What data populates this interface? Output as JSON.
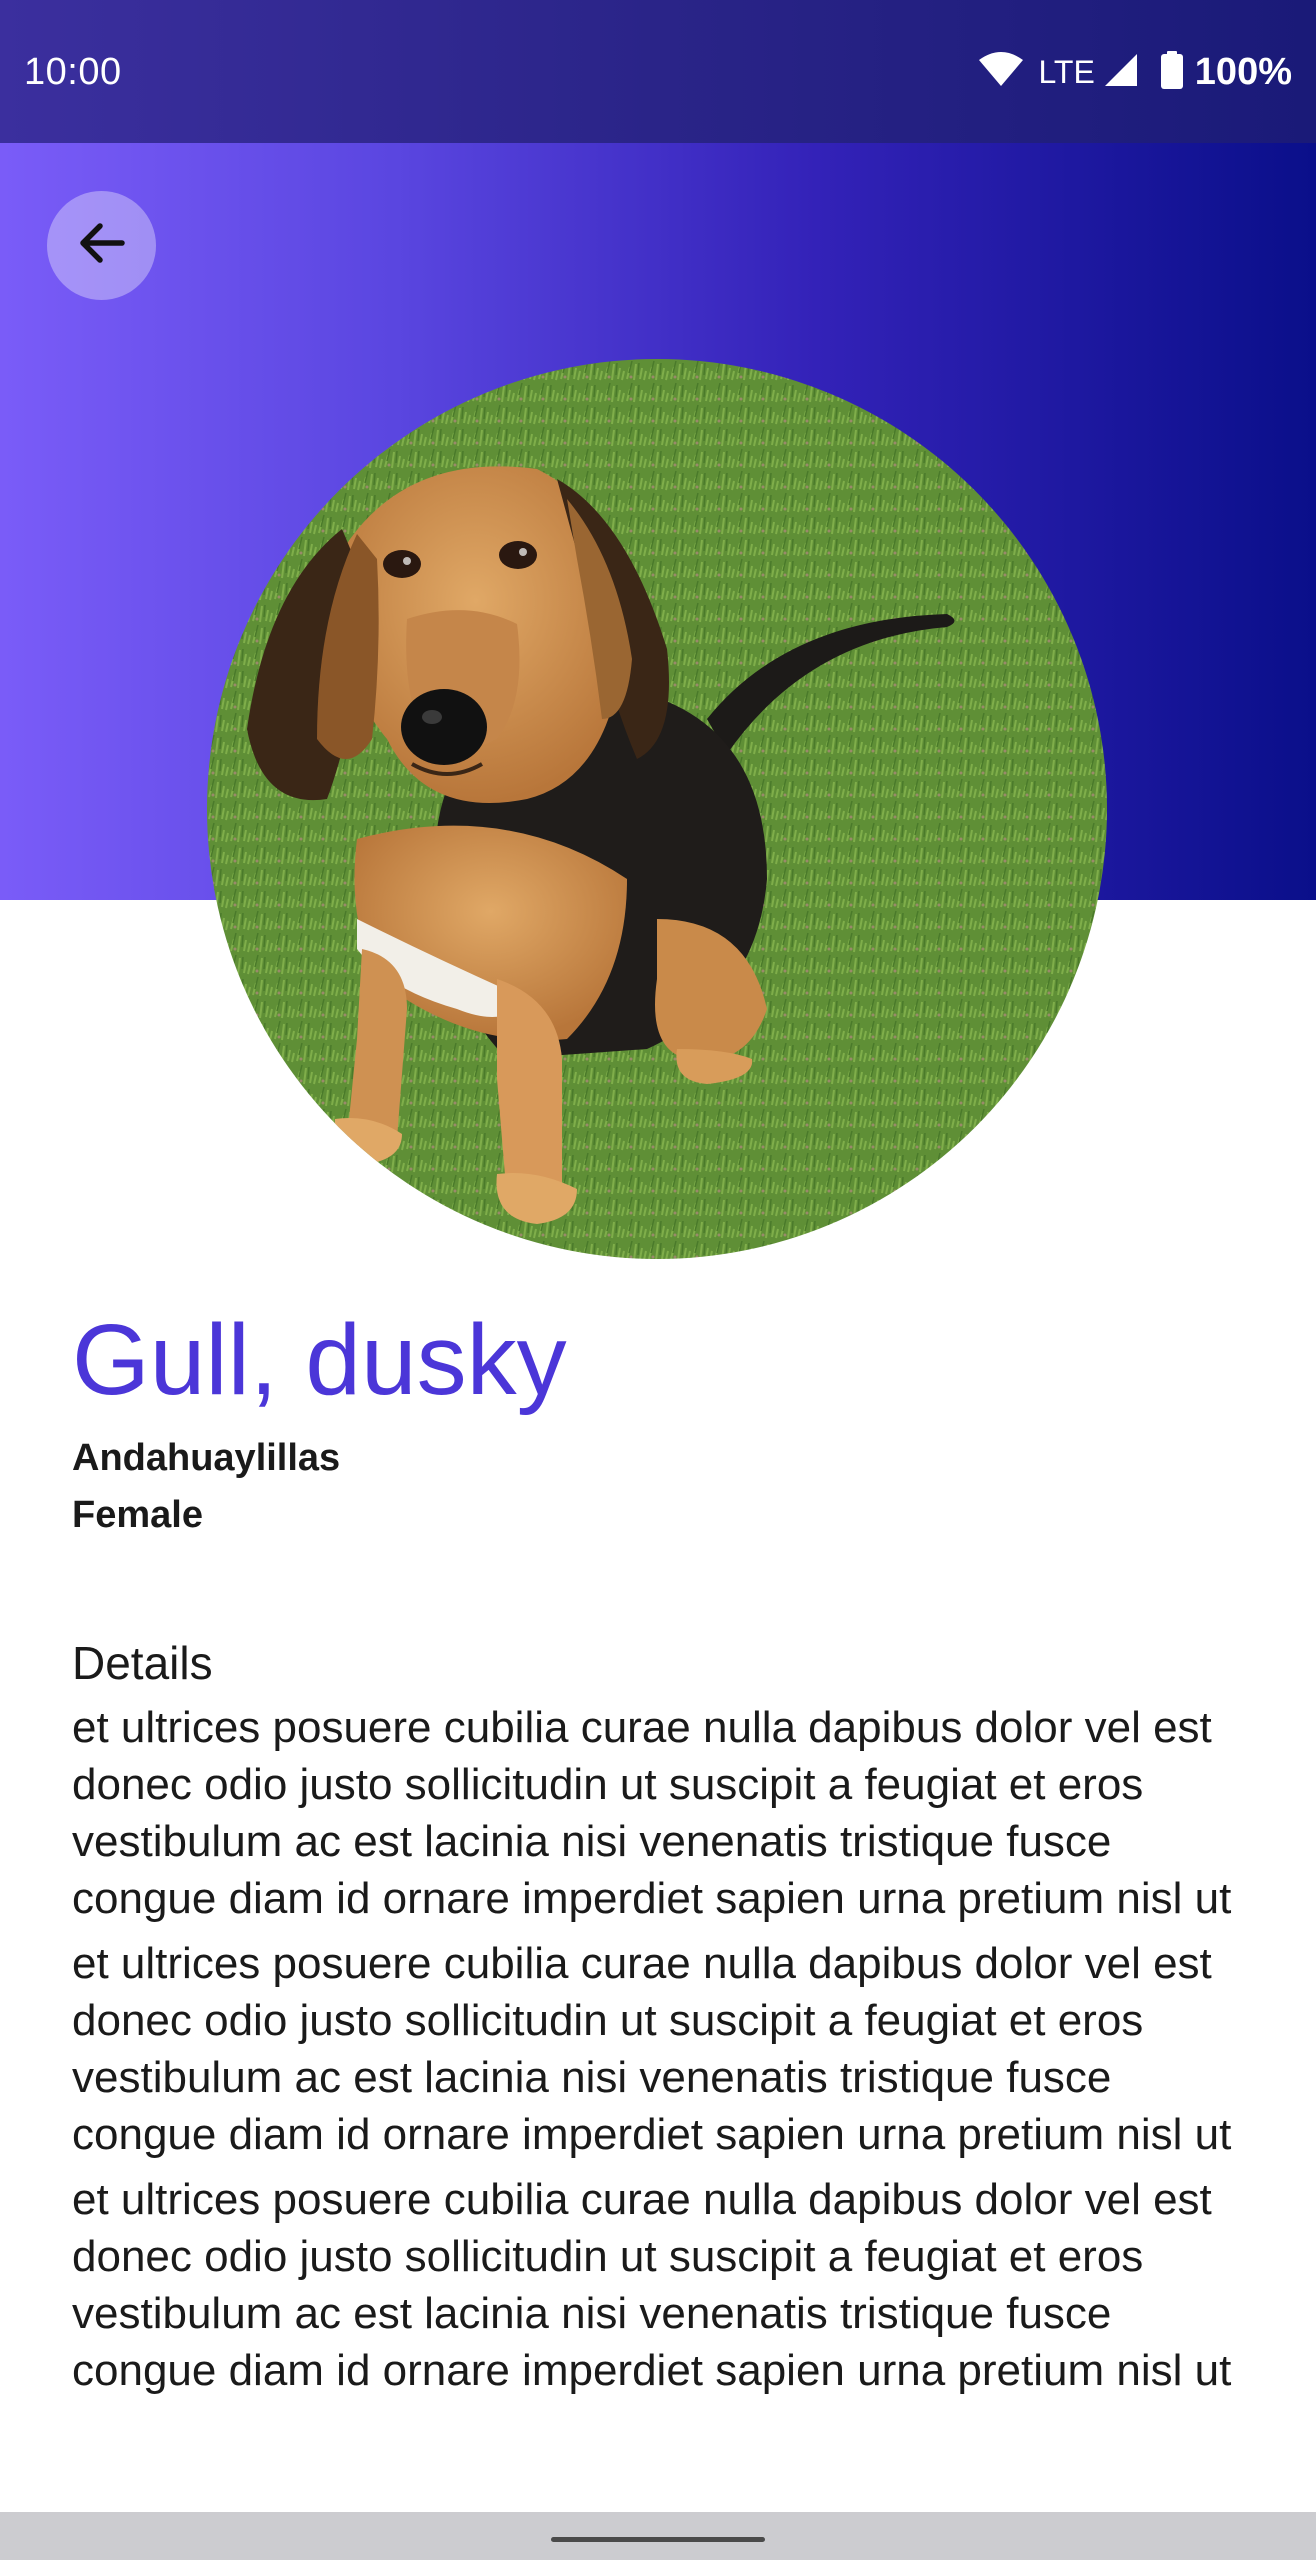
{
  "status_bar": {
    "time": "10:00",
    "network": "LTE",
    "battery": "100%",
    "icons": [
      "wifi-icon",
      "cell-signal-icon",
      "battery-icon"
    ]
  },
  "header": {
    "back_icon": "arrow-back-icon",
    "gradient_colors": [
      "#7a5cf8",
      "#3322b8",
      "#0a0f8a"
    ]
  },
  "pet": {
    "name": "Gull, dusky",
    "location": "Andahuaylillas",
    "gender": "Female",
    "photo_subject": "dog sitting on grass"
  },
  "details": {
    "label": "Details",
    "paragraphs": [
      "et ultrices posuere cubilia curae nulla dapibus dolor vel est donec odio justo sollicitudin ut suscipit a feugiat et eros vestibulum ac est lacinia nisi venenatis tristique fusce congue diam id ornare imperdiet sapien urna pretium nisl ut",
      "et ultrices posuere cubilia curae nulla dapibus dolor vel est donec odio justo sollicitudin ut suscipit a feugiat et eros vestibulum ac est lacinia nisi venenatis tristique fusce congue diam id ornare imperdiet sapien urna pretium nisl ut",
      "et ultrices posuere cubilia curae nulla dapibus dolor vel est donec odio justo sollicitudin ut suscipit a feugiat et eros vestibulum ac est lacinia nisi venenatis tristique fusce congue diam id ornare imperdiet sapien urna pretium nisl ut"
    ]
  },
  "colors": {
    "accent": "#4b36d8",
    "text": "#1a1a1a"
  }
}
